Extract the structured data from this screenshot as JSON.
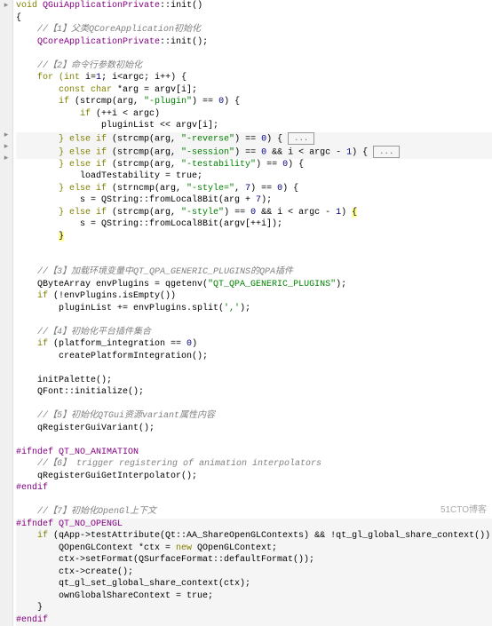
{
  "watermark": "51CTO博客",
  "fold_text": "...",
  "gutter": {
    "marker_glyph": "▸"
  },
  "code": {
    "l0": "void ",
    "l0b": "QGuiApplicationPrivate",
    "l0c": "::",
    "l0d": "init",
    "l0e": "()",
    "l1": "{",
    "l2": "    //【1】父类QCoreApplication初始化",
    "l3a": "    QCoreApplicationPrivate",
    "l3b": "::",
    "l3c": "init",
    "l3d": "();",
    "l5": "    //【2】命令行参数初始化",
    "l6a": "    for ",
    "l6b": "(int ",
    "l6c": "i=",
    "l6d": "1",
    "l6e": "; i<argc; i++) {",
    "l7a": "        const char ",
    "l7b": "*arg = argv[i];",
    "l8a": "        if ",
    "l8b": "(strcmp(arg, ",
    "l8c": "\"-plugin\"",
    "l8d": ") == ",
    "l8e": "0",
    "l8f": ") {",
    "l9a": "            if ",
    "l9b": "(++i < argc)",
    "l10a": "                pluginList << argv[i];",
    "l11a": "        } else if ",
    "l11b": "(strcmp(arg, ",
    "l11c": "\"-reverse\"",
    "l11d": ") == ",
    "l11e": "0",
    "l11f": ") { ",
    "l12a": "        } else if ",
    "l12b": "(strcmp(arg, ",
    "l12c": "\"-session\"",
    "l12d": ") == ",
    "l12e": "0",
    "l12f": " && i < argc - ",
    "l12g": "1",
    "l12h": ") { ",
    "l13a": "        } else if ",
    "l13b": "(strcmp(arg, ",
    "l13c": "\"-testability\"",
    "l13d": ") == ",
    "l13e": "0",
    "l13f": ") {",
    "l14a": "            loadTestability = true;",
    "l15a": "        } else if ",
    "l15b": "(strncmp(arg, ",
    "l15c": "\"-style=\"",
    "l15d": ", ",
    "l15e": "7",
    "l15f": ") == ",
    "l15g": "0",
    "l15h": ") {",
    "l16a": "            s = QString::fromLocal8Bit(arg + ",
    "l16b": "7",
    "l16c": ");",
    "l17a": "        } else if ",
    "l17b": "(strcmp(arg, ",
    "l17c": "\"-style\"",
    "l17d": ") == ",
    "l17e": "0",
    "l17f": " && i < argc - ",
    "l17g": "1",
    "l17h": ") ",
    "l17i": "{",
    "l18a": "            s = QString::fromLocal8Bit(argv[++i]);",
    "l19a": "        ",
    "l19b": "}",
    "l21": "    //【3】加载环境变量中QT_QPA_GENERIC_PLUGINS的QPA插件",
    "l22a": "    QByteArray envPlugins = qgetenv(",
    "l22b": "\"QT_QPA_GENERIC_PLUGINS\"",
    "l22c": ");",
    "l23a": "    if ",
    "l23b": "(!envPlugins.isEmpty())",
    "l24a": "        pluginList += envPlugins.split(",
    "l24b": "','",
    "l24c": ");",
    "l26": "    //【4】初始化平台插件集合",
    "l27a": "    if ",
    "l27b": "(platform_integration == ",
    "l27c": "0",
    "l27d": ")",
    "l28a": "        createPlatformIntegration();",
    "l30a": "    initPalette();",
    "l31a": "    QFont::initialize();",
    "l33": "    //【5】初始化QTGui资源variant属性内容",
    "l34a": "    qRegisterGuiVariant();",
    "l36a": "#ifndef ",
    "l36b": "QT_NO_ANIMATION",
    "l37": "    //【6】 trigger registering of animation interpolators",
    "l38a": "    qRegisterGuiGetInterpolator();",
    "l39a": "#endif",
    "l41": "    //【7】初始化OpenGl上下文",
    "l42a": "#ifndef ",
    "l42b": "QT_NO_OPENGL",
    "l43a": "    if ",
    "l43b": "(qApp->testAttribute(Qt::AA_ShareOpenGLContexts) && !qt_gl_global_share_context()) {",
    "l44a": "        QOpenGLContext *ctx = ",
    "l44b": "new ",
    "l44c": "QOpenGLContext;",
    "l45a": "        ctx->setFormat(QSurfaceFormat::defaultFormat());",
    "l46a": "        ctx->create();",
    "l47a": "        qt_gl_set_global_share_context(ctx);",
    "l48a": "        ownGlobalShareContext = true;",
    "l49a": "    }",
    "l50a": "#endif"
  }
}
